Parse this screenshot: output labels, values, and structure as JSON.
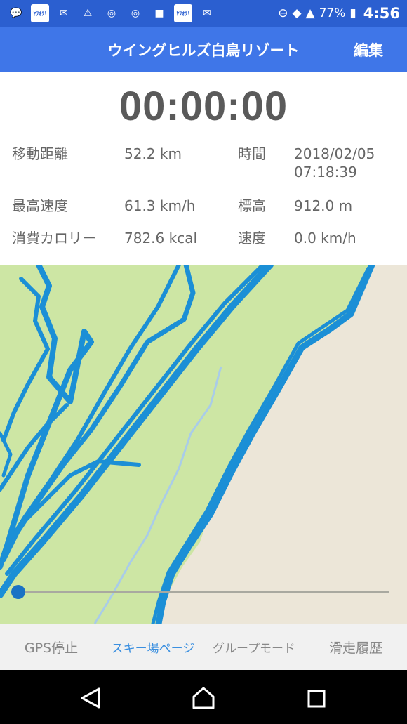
{
  "status_bar": {
    "battery": "77%",
    "time": "4:56"
  },
  "app_bar": {
    "title": "ウイングヒルズ白鳥リゾート",
    "edit_label": "編集"
  },
  "stats": {
    "timer": "00:00:00",
    "distance_label": "移動距離",
    "distance_value": "52.2 km",
    "time_label": "時間",
    "time_value_date": "2018/02/05",
    "time_value_clock": "07:18:39",
    "max_speed_label": "最高速度",
    "max_speed_value": "61.3 km/h",
    "altitude_label": "標高",
    "altitude_value": "912.0 m",
    "calories_label": "消費カロリー",
    "calories_value": "782.6 kcal",
    "speed_label": "速度",
    "speed_value": "0.0 km/h"
  },
  "playback": {
    "progress": 0
  },
  "tabs": [
    {
      "label": "GPS停止"
    },
    {
      "label": "スキー場ページ"
    },
    {
      "label": "グループモード"
    },
    {
      "label": "滑走履歴"
    }
  ],
  "colors": {
    "status_bar": "#2b5fd0",
    "app_bar": "#3f76e8",
    "track": "#1b8fd6",
    "active_tab": "#3a8fe0",
    "map_green": "#cde6a4",
    "map_sand": "#ece6d8"
  }
}
